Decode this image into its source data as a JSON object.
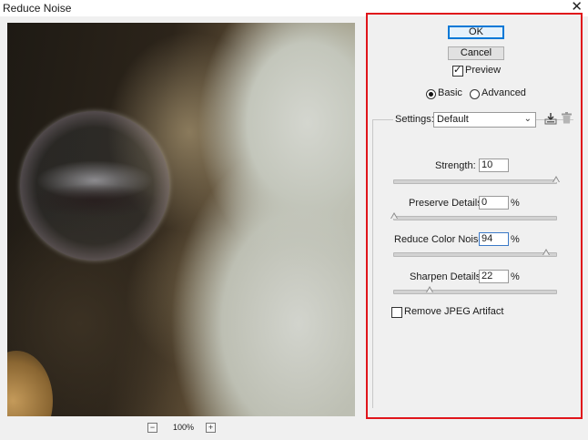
{
  "window": {
    "title": "Reduce Noise",
    "close_symbol": "✕"
  },
  "zoom": {
    "minus": "−",
    "value": "100%",
    "plus": "+"
  },
  "buttons": {
    "ok": "OK",
    "cancel": "Cancel"
  },
  "preview_toggle": {
    "label": "Preview",
    "checked": true
  },
  "mode": {
    "basic": "Basic",
    "advanced": "Advanced",
    "selected": "Basic"
  },
  "settings": {
    "label": "Settings:",
    "value": "Default"
  },
  "controls": [
    {
      "label": "Strength:",
      "value": "10",
      "percent": "",
      "level": 1.0
    },
    {
      "label": "Preserve Details:",
      "value": "0",
      "percent": "%",
      "level": 0.0
    },
    {
      "label": "Reduce Color Noise:",
      "value": "94",
      "percent": "%",
      "level": 0.94
    },
    {
      "label": "Sharpen Details:",
      "value": "22",
      "percent": "%",
      "level": 0.22
    }
  ],
  "jpeg_artifact": {
    "label": "Remove JPEG Artifact",
    "checked": false
  },
  "colors": {
    "highlight_border": "#e0151b",
    "focus_border": "#3b79c7",
    "default_button": "#0078d7"
  }
}
